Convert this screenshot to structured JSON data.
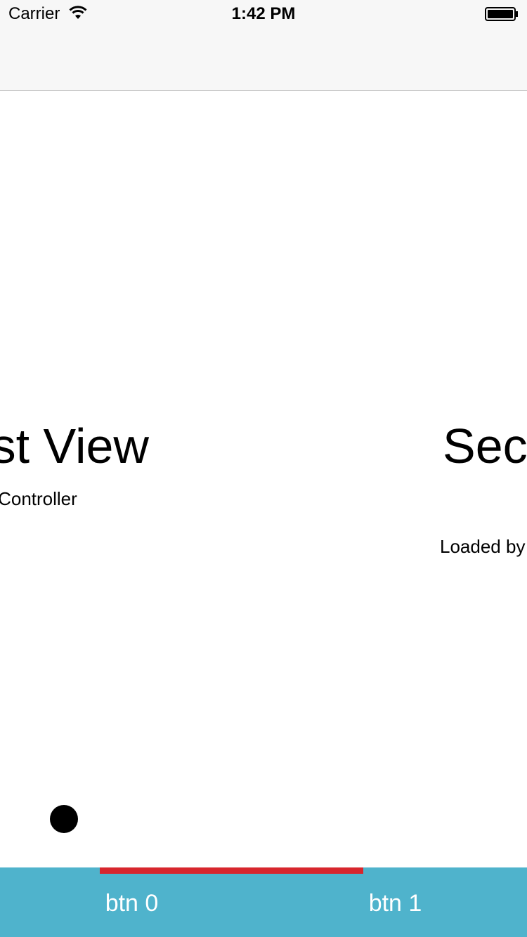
{
  "status_bar": {
    "carrier": "Carrier",
    "time": "1:42 PM",
    "wifi_icon": "wifi-icon",
    "battery_icon": "battery-icon"
  },
  "pages": [
    {
      "title": "First View",
      "subtitle": "Loaded by FirstViewController"
    },
    {
      "title": "Second View",
      "subtitle": "Loaded by SecondViewController"
    }
  ],
  "tab_bar": {
    "background": "#4fb3cc",
    "indicator_color": "#d7262d",
    "tabs": [
      {
        "label": "btn 0"
      },
      {
        "label": "btn 1"
      }
    ]
  }
}
